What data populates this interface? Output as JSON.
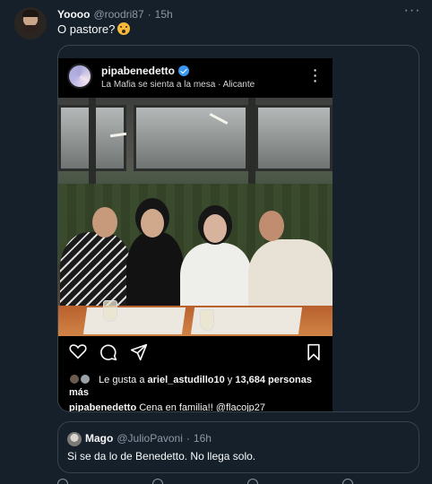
{
  "tweet": {
    "author_name": "Yoooo",
    "handle": "@roodri87",
    "separator": "·",
    "time": "15h",
    "text": "O pastore?",
    "more_icon": "more-horizontal-icon",
    "emoji": "astonished-face-emoji"
  },
  "instagram_post": {
    "username": "pipabenedetto",
    "verified_icon": "verified-badge-icon",
    "location": "La Mafia se sienta a la mesa · Alicante",
    "more_icon": "more-vertical-icon",
    "photo_description_icon": "group-photo",
    "actions": [
      "heart-icon",
      "comment-icon",
      "share-icon",
      "bookmark-icon"
    ],
    "likes_prefix": "Le gusta a",
    "likes_user": "ariel_astudillo10",
    "likes_middle": "y",
    "likes_count": "13,684 personas",
    "likes_suffix": "más",
    "caption_user": "pipabenedetto",
    "caption_text": "Cena en familia!! @flacojp27"
  },
  "quoted_tweet": {
    "author_name": "Mago",
    "handle": "@JulioPavoni",
    "separator": "·",
    "time": "16h",
    "text": "Si se da lo de Benedetto. No llega solo."
  },
  "colors": {
    "background": "#15202b",
    "border": "#38444d",
    "secondary_text": "#8b98a5",
    "verified": "#3897f0"
  }
}
